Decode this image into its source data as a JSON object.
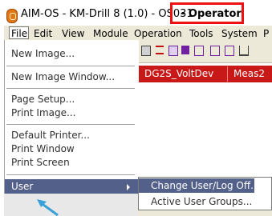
{
  "window": {
    "title_prefix": "AIM-OS - KM-Drill 8 (1.0) - OS031 ",
    "title_role": "- Operator"
  },
  "menubar": {
    "items": [
      "File",
      "Edit",
      "View",
      "Module",
      "Operation",
      "Tools",
      "System",
      "P"
    ]
  },
  "tabs": [
    {
      "label": "DG2S_VoltDev"
    },
    {
      "label": "Meas2"
    }
  ],
  "file_menu": {
    "items": [
      {
        "label": "New Image..."
      },
      {
        "label": "New Image Window..."
      },
      {
        "label": "Page Setup..."
      },
      {
        "label": "Print Image..."
      },
      {
        "label": "Default Printer..."
      },
      {
        "label": "Print Window"
      },
      {
        "label": "Print Screen"
      },
      {
        "label": "User"
      }
    ]
  },
  "user_submenu": {
    "items": [
      {
        "label": "Change User/Log Off..."
      },
      {
        "label": "Active User Groups..."
      }
    ]
  },
  "colors": {
    "highlight_box": "#ee1111",
    "selected_row": "#53608a",
    "tab_strip": "#c81818"
  },
  "icons": [
    "app-icon",
    "submenu-arrow-icon",
    "pointer-arrow-icon"
  ]
}
